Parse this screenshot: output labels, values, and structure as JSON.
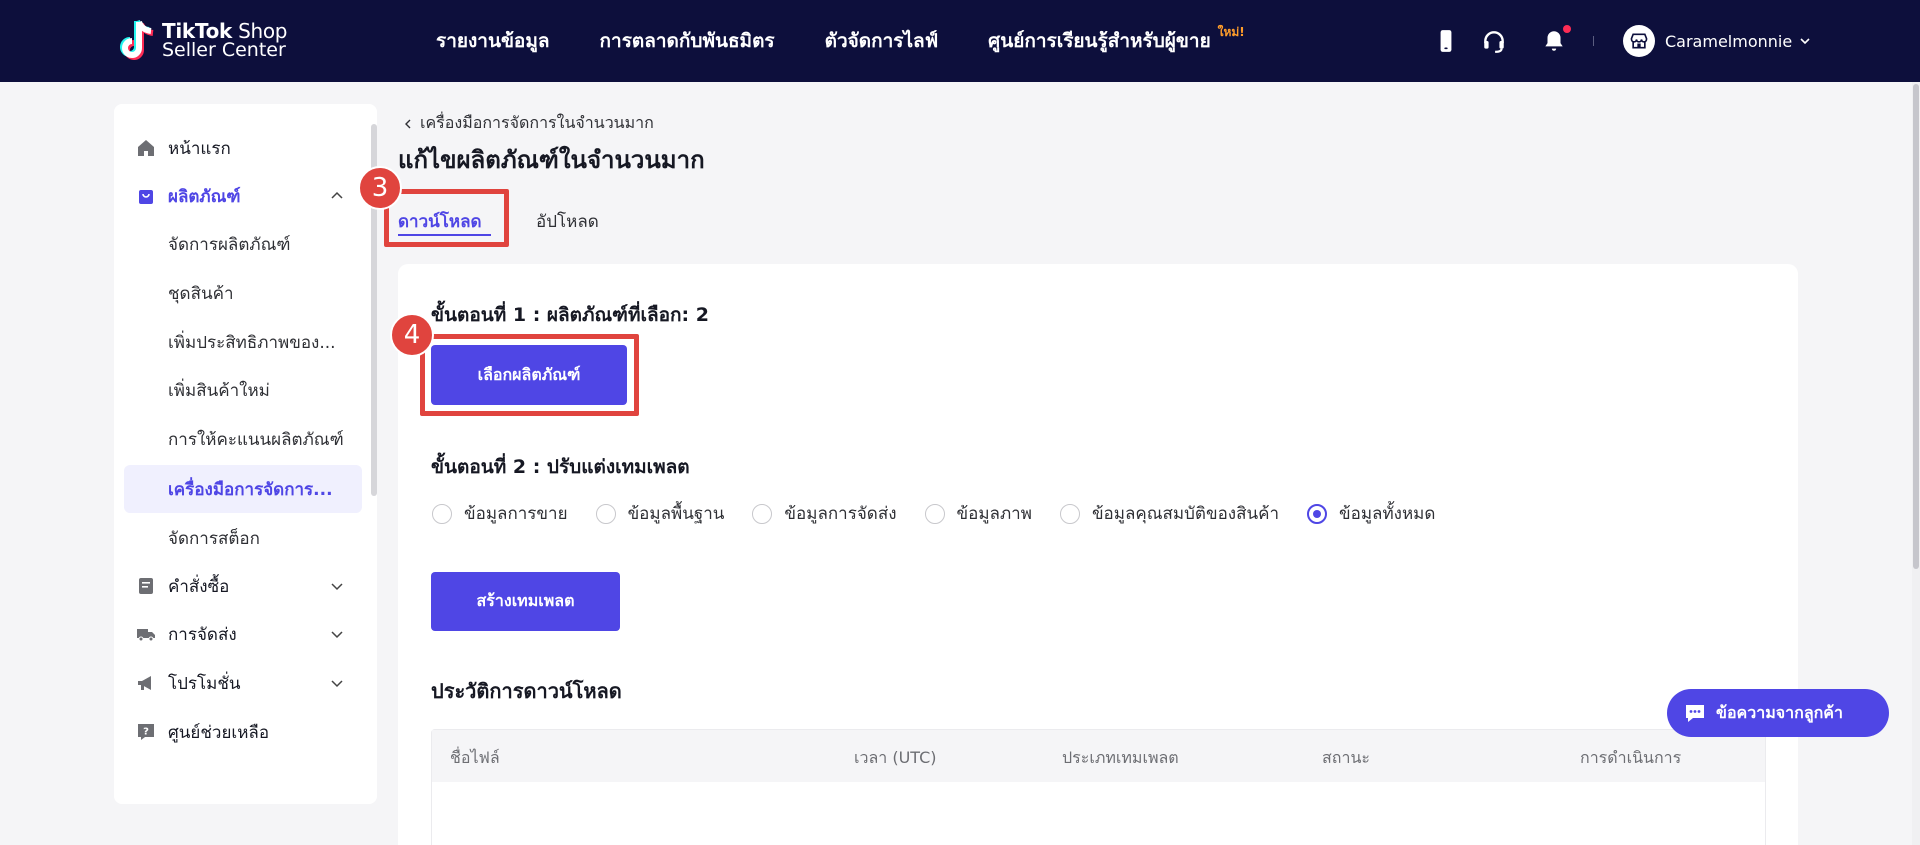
{
  "brand": {
    "line1_bold": "TikTok",
    "line1_regular": " Shop",
    "line2": "Seller Center"
  },
  "topnav": {
    "items": [
      "รายงานข้อมูล",
      "การตลาดกับพันธมิตร",
      "ตัวจัดการไลฟ์",
      "ศูนย์การเรียนรู้สำหรับผู้ขาย"
    ],
    "new_badge": "ใหม่!"
  },
  "account": {
    "name": "Caramelmonnie"
  },
  "sidebar": {
    "home": "หน้าแรก",
    "products": "ผลิตภัณฑ์",
    "product_sub": [
      "จัดการผลิตภัณฑ์",
      "ชุดสินค้า",
      "เพิ่มประสิทธิภาพของ...",
      "เพิ่มสินค้าใหม่",
      "การให้คะแนนผลิตภัณฑ์",
      "เครื่องมือการจัดการ...",
      "จัดการสต็อก"
    ],
    "orders": "คำสั่งซื้อ",
    "shipping": "การจัดส่ง",
    "promotions": "โปรโมชั่น",
    "help": "ศูนย์ช่วยเหลือ"
  },
  "breadcrumb": "เครื่องมือการจัดการในจำนวนมาก",
  "page_title": "แก้ไขผลิตภัณฑ์ในจำนวนมาก",
  "tabs": {
    "download": "ดาวน์โหลด",
    "upload": "อัปโหลด"
  },
  "annotations": {
    "tab_marker": "3",
    "button_marker": "4"
  },
  "step1": {
    "label": "ขั้นตอนที่ 1 :  ผลิตภัณฑ์ที่เลือก: 2",
    "button": "เลือกผลิตภัณฑ์"
  },
  "step2": {
    "label": "ขั้นตอนที่ 2 :  ปรับแต่งเทมเพลต",
    "options": [
      "ข้อมูลการขาย",
      "ข้อมูลพื้นฐาน",
      "ข้อมูลการจัดส่ง",
      "ข้อมูลภาพ",
      "ข้อมูลคุณสมบัติของสินค้า",
      "ข้อมูลทั้งหมด"
    ],
    "selected_index": 5,
    "button": "สร้างเทมเพลต"
  },
  "history": {
    "title": "ประวัติการดาวน์โหลด",
    "columns": [
      "ชื่อไฟล์",
      "เวลา (UTC)",
      "ประเภทเทมเพลต",
      "สถานะ",
      "การดำเนินการ"
    ]
  },
  "chat": {
    "label": "ข้อความจากลูกค้า"
  },
  "colors": {
    "nav_bg": "#0d0f3c",
    "primary": "#4f46e5",
    "annotation": "#e0443e"
  }
}
